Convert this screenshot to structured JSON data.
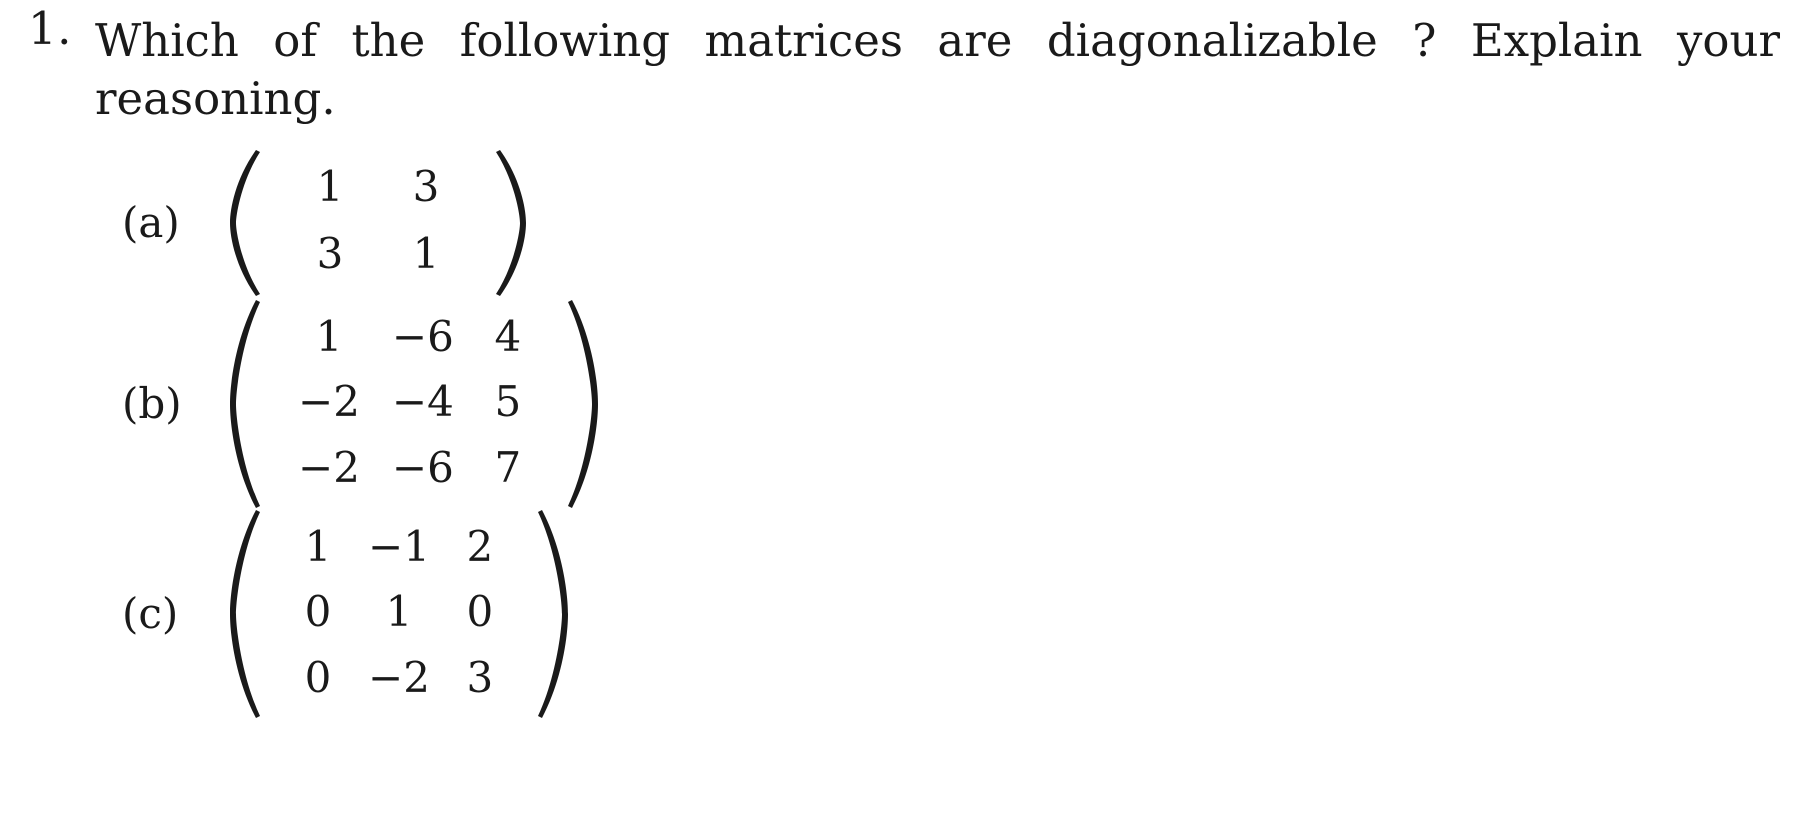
{
  "document": {
    "problem": {
      "number": "1.",
      "line1": "Which of the following matrices are diagonalizable ?   Explain your",
      "line2": "reasoning.",
      "full_text": "Which of the following matrices are diagonalizable ?  Explain your reasoning."
    },
    "subitems": [
      {
        "label": "(a)",
        "matrix": {
          "rows": 2,
          "cols": 2,
          "values": [
            [
              "1",
              "3"
            ],
            [
              "3",
              "1"
            ]
          ],
          "bracket": "parenthesis"
        }
      },
      {
        "label": "(b)",
        "matrix": {
          "rows": 3,
          "cols": 3,
          "values": [
            [
              "1",
              "−6",
              "4"
            ],
            [
              "−2",
              "−4",
              "5"
            ],
            [
              "−2",
              "−6",
              "7"
            ]
          ],
          "bracket": "parenthesis"
        }
      },
      {
        "label": "(c)",
        "matrix": {
          "rows": 3,
          "cols": 3,
          "values": [
            [
              "1",
              "−1",
              "2"
            ],
            [
              "0",
              "1",
              "0"
            ],
            [
              "0",
              "−2",
              "3"
            ]
          ],
          "bracket": "parenthesis"
        }
      }
    ]
  },
  "colors": {
    "background": "#ffffff",
    "text": "#1a1a1a"
  }
}
